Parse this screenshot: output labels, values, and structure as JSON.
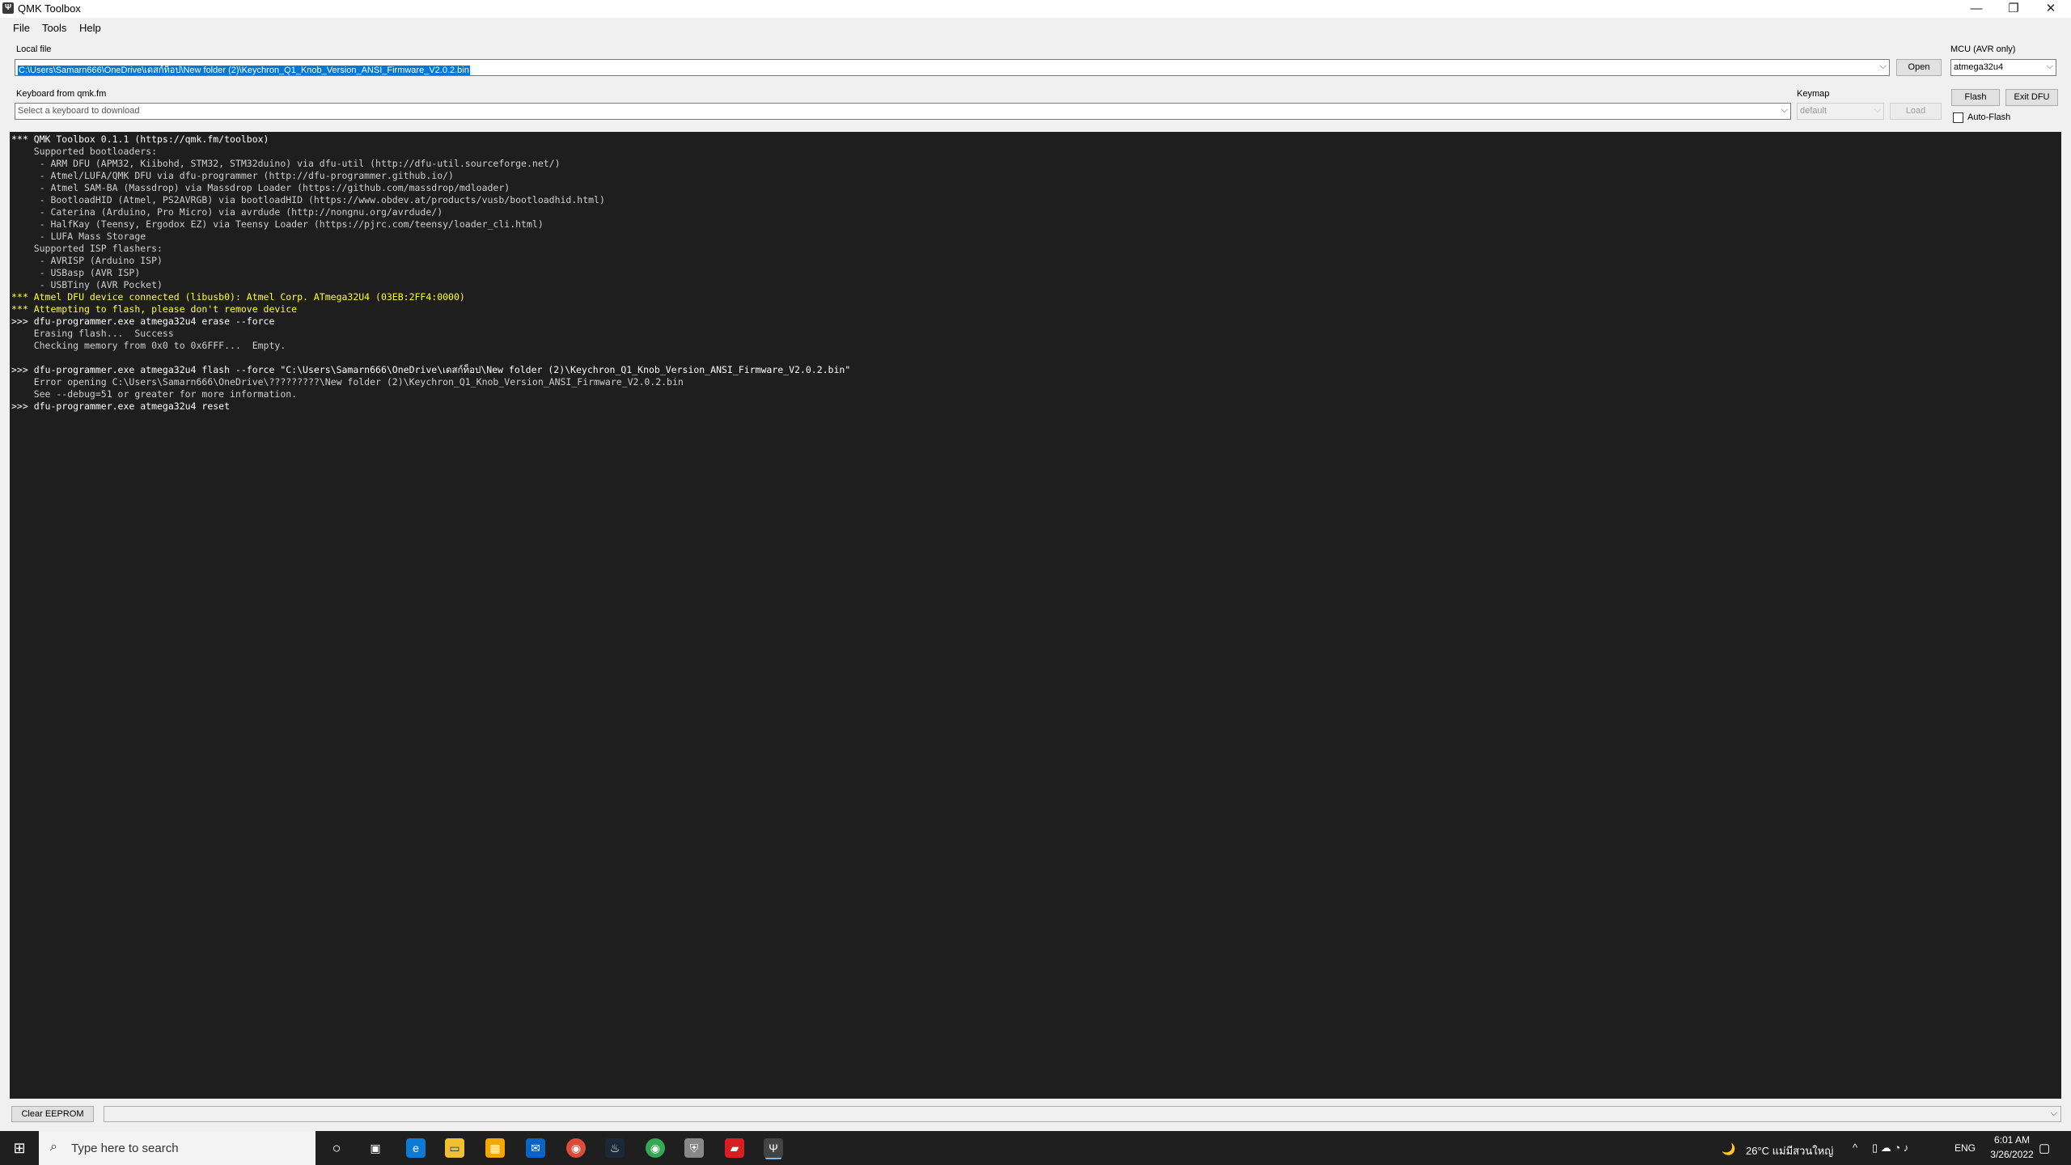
{
  "window": {
    "title": "QMK Toolbox"
  },
  "menu": [
    "File",
    "Tools",
    "Help"
  ],
  "local_file": {
    "label": "Local file",
    "value": "C:\\Users\\Samarn666\\OneDrive\\เดสก์ท็อป\\New folder (2)\\Keychron_Q1_Knob_Version_ANSI_Firmware_V2.0.2.bin",
    "open_label": "Open"
  },
  "mcu": {
    "label": "MCU (AVR only)",
    "value": "atmega32u4"
  },
  "keyboard": {
    "label": "Keyboard from qmk.fm",
    "placeholder": "Select a keyboard to download"
  },
  "keymap": {
    "label": "Keymap",
    "value": "default",
    "load_label": "Load"
  },
  "buttons": {
    "flash": "Flash",
    "exit_dfu": "Exit DFU",
    "auto_flash": "Auto-Flash",
    "clear_eeprom": "Clear EEPROM"
  },
  "console_lines": [
    {
      "t": "*** QMK Toolbox 0.1.1 (https://qmk.fm/toolbox)",
      "c": "white"
    },
    {
      "t": "    Supported bootloaders:",
      "c": "gray"
    },
    {
      "t": "     - ARM DFU (APM32, Kiibohd, STM32, STM32duino) via dfu-util (http://dfu-util.sourceforge.net/)",
      "c": "gray"
    },
    {
      "t": "     - Atmel/LUFA/QMK DFU via dfu-programmer (http://dfu-programmer.github.io/)",
      "c": "gray"
    },
    {
      "t": "     - Atmel SAM-BA (Massdrop) via Massdrop Loader (https://github.com/massdrop/mdloader)",
      "c": "gray"
    },
    {
      "t": "     - BootloadHID (Atmel, PS2AVRGB) via bootloadHID (https://www.obdev.at/products/vusb/bootloadhid.html)",
      "c": "gray"
    },
    {
      "t": "     - Caterina (Arduino, Pro Micro) via avrdude (http://nongnu.org/avrdude/)",
      "c": "gray"
    },
    {
      "t": "     - HalfKay (Teensy, Ergodox EZ) via Teensy Loader (https://pjrc.com/teensy/loader_cli.html)",
      "c": "gray"
    },
    {
      "t": "     - LUFA Mass Storage",
      "c": "gray"
    },
    {
      "t": "    Supported ISP flashers:",
      "c": "gray"
    },
    {
      "t": "     - AVRISP (Arduino ISP)",
      "c": "gray"
    },
    {
      "t": "     - USBasp (AVR ISP)",
      "c": "gray"
    },
    {
      "t": "     - USBTiny (AVR Pocket)",
      "c": "gray"
    },
    {
      "t": "*** Atmel DFU device connected (libusb0): Atmel Corp. ATmega32U4 (03EB:2FF4:0000)",
      "c": "yellow"
    },
    {
      "t": "*** Attempting to flash, please don't remove device",
      "c": "yellow"
    },
    {
      "t": ">>> dfu-programmer.exe atmega32u4 erase --force",
      "c": "white"
    },
    {
      "t": "    Erasing flash...  Success",
      "c": "gray"
    },
    {
      "t": "    Checking memory from 0x0 to 0x6FFF...  Empty.",
      "c": "gray"
    },
    {
      "t": "",
      "c": "gray"
    },
    {
      "t": ">>> dfu-programmer.exe atmega32u4 flash --force \"C:\\Users\\Samarn666\\OneDrive\\เดสก์ท็อป\\New folder (2)\\Keychron_Q1_Knob_Version_ANSI_Firmware_V2.0.2.bin\"",
      "c": "white"
    },
    {
      "t": "    Error opening C:\\Users\\Samarn666\\OneDrive\\?????????\\New folder (2)\\Keychron_Q1_Knob_Version_ANSI_Firmware_V2.0.2.bin",
      "c": "gray"
    },
    {
      "t": "    See --debug=51 or greater for more information.",
      "c": "gray"
    },
    {
      "t": ">>> dfu-programmer.exe atmega32u4 reset",
      "c": "white"
    }
  ],
  "taskbar": {
    "search_placeholder": "Type here to search",
    "weather": "26°C  แม่มีสวนใหญ่",
    "lang": "ENG",
    "time": "6:01 AM",
    "date": "3/26/2022"
  }
}
